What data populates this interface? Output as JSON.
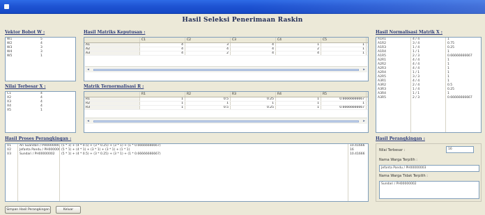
{
  "window": {
    "title": ""
  },
  "main_title": "Hasil Seleksi Penerimaan Raskin",
  "labels": {
    "vektor_bobot": "Vektor Bobot W :",
    "matriks_keputusan": "Hasil Matriks Keputusan :",
    "normalisasi": "Hasil Normalisasi Matrik X :",
    "nilai_terbesar": "Nilai Terbesar X :",
    "matrik_ternormal": "Matrik Ternormalisasi R :",
    "proses_perangkingan": "Hasil Proses Perangkingan :",
    "hasil_perangkingan": "Hasil Perangkingan :"
  },
  "vektor_bobot": [
    {
      "k": "W1",
      "v": "5"
    },
    {
      "k": "W2",
      "v": "4"
    },
    {
      "k": "W3",
      "v": "3"
    },
    {
      "k": "W4",
      "v": "3"
    },
    {
      "k": "W5",
      "v": "1"
    }
  ],
  "matriks_keputusan": {
    "headers": [
      "",
      "C1",
      "C2",
      "C3",
      "C4",
      "C5"
    ],
    "rows": [
      [
        "A1",
        "4",
        "3",
        "4",
        "1",
        "1"
      ],
      [
        "A2",
        "4",
        "4",
        "4",
        "2",
        "1"
      ],
      [
        "A3",
        "4",
        "2",
        "4",
        "4",
        "1"
      ]
    ]
  },
  "nilai_terbesar": [
    {
      "k": "C1",
      "v": "4"
    },
    {
      "k": "X2",
      "v": "4"
    },
    {
      "k": "X3",
      "v": "4"
    },
    {
      "k": "X4",
      "v": "4"
    },
    {
      "k": "X5",
      "v": "1"
    }
  ],
  "matrik_ternormal": {
    "headers": [
      "",
      "R1",
      "R2",
      "R3",
      "R4",
      "R5"
    ],
    "rows": [
      [
        "R1",
        "1",
        "0.5",
        "0.25",
        "1",
        "0.66666666667"
      ],
      [
        "R2",
        "1",
        "1",
        "1",
        "1",
        "1"
      ],
      [
        "R3",
        "1",
        "0.5",
        "0.25",
        "1",
        "0.66666666667"
      ]
    ]
  },
  "normalisasi": [
    {
      "a": "A1R1",
      "b": "4 / 4",
      "c": "1"
    },
    {
      "a": "A1R2",
      "b": "3 / 4",
      "c": "0.75"
    },
    {
      "a": "A1R3",
      "b": "1 / 4",
      "c": "0.25"
    },
    {
      "a": "A1R4",
      "b": "1 / 1",
      "c": "1"
    },
    {
      "a": "A1R5",
      "b": "2 / 3",
      "c": "0.66666666667"
    },
    {
      "a": "A2R1",
      "b": "4 / 4",
      "c": "1"
    },
    {
      "a": "A2R2",
      "b": "4 / 4",
      "c": "1"
    },
    {
      "a": "A2R3",
      "b": "4 / 4",
      "c": "1"
    },
    {
      "a": "A2R4",
      "b": "1 / 1",
      "c": "1"
    },
    {
      "a": "A2R5",
      "b": "3 / 3",
      "c": "1"
    },
    {
      "a": "A3R1",
      "b": "4 / 4",
      "c": "1"
    },
    {
      "a": "A3R2",
      "b": "2 / 4",
      "c": "0.5"
    },
    {
      "a": "A3R3",
      "b": "1 / 4",
      "c": "0.25"
    },
    {
      "a": "A3R4",
      "b": "1 / 1",
      "c": "1"
    },
    {
      "a": "A3R5",
      "b": "2 / 3",
      "c": "0.66666666667"
    }
  ],
  "proses": [
    {
      "id": "V1",
      "nama": "Ari Suandari / PH00000001",
      "rumus": "(5 * 1) + (4 * 0.5) + (3 * 0.25) + (3 * 1) + (1 * 0.66666666667)",
      "hasil": "10.41666"
    },
    {
      "id": "V2",
      "nama": "Jefanta Pandu / PH00000003",
      "rumus": "(5 * 1) + (4 * 1) + (3 * 1) + (3 * 1) + (1 * 1)",
      "hasil": "16"
    },
    {
      "id": "V3",
      "nama": "Sundari / PH00000002",
      "rumus": "(5 * 1) + (4 * 0.5) + (3 * 0.25) + (3 * 1) + (1 * 0.66666666667)",
      "hasil": "10.41666"
    }
  ],
  "hasil": {
    "nilai_terbesar_label": "Nilai Terbesar :",
    "nilai_terbesar_value": "16",
    "nama_layak_label": "Nama Warga Terpilih :",
    "nama_layak_value": "Jefanta Pandu / PH00000003",
    "nama_tidak_label": "Nama Warga Tidak Terpilih :",
    "nama_tidak_value": "Sundari / PH00000002"
  },
  "buttons": {
    "proses": "Simpan Hasil Perangkingan",
    "keluar": "Keluar"
  }
}
